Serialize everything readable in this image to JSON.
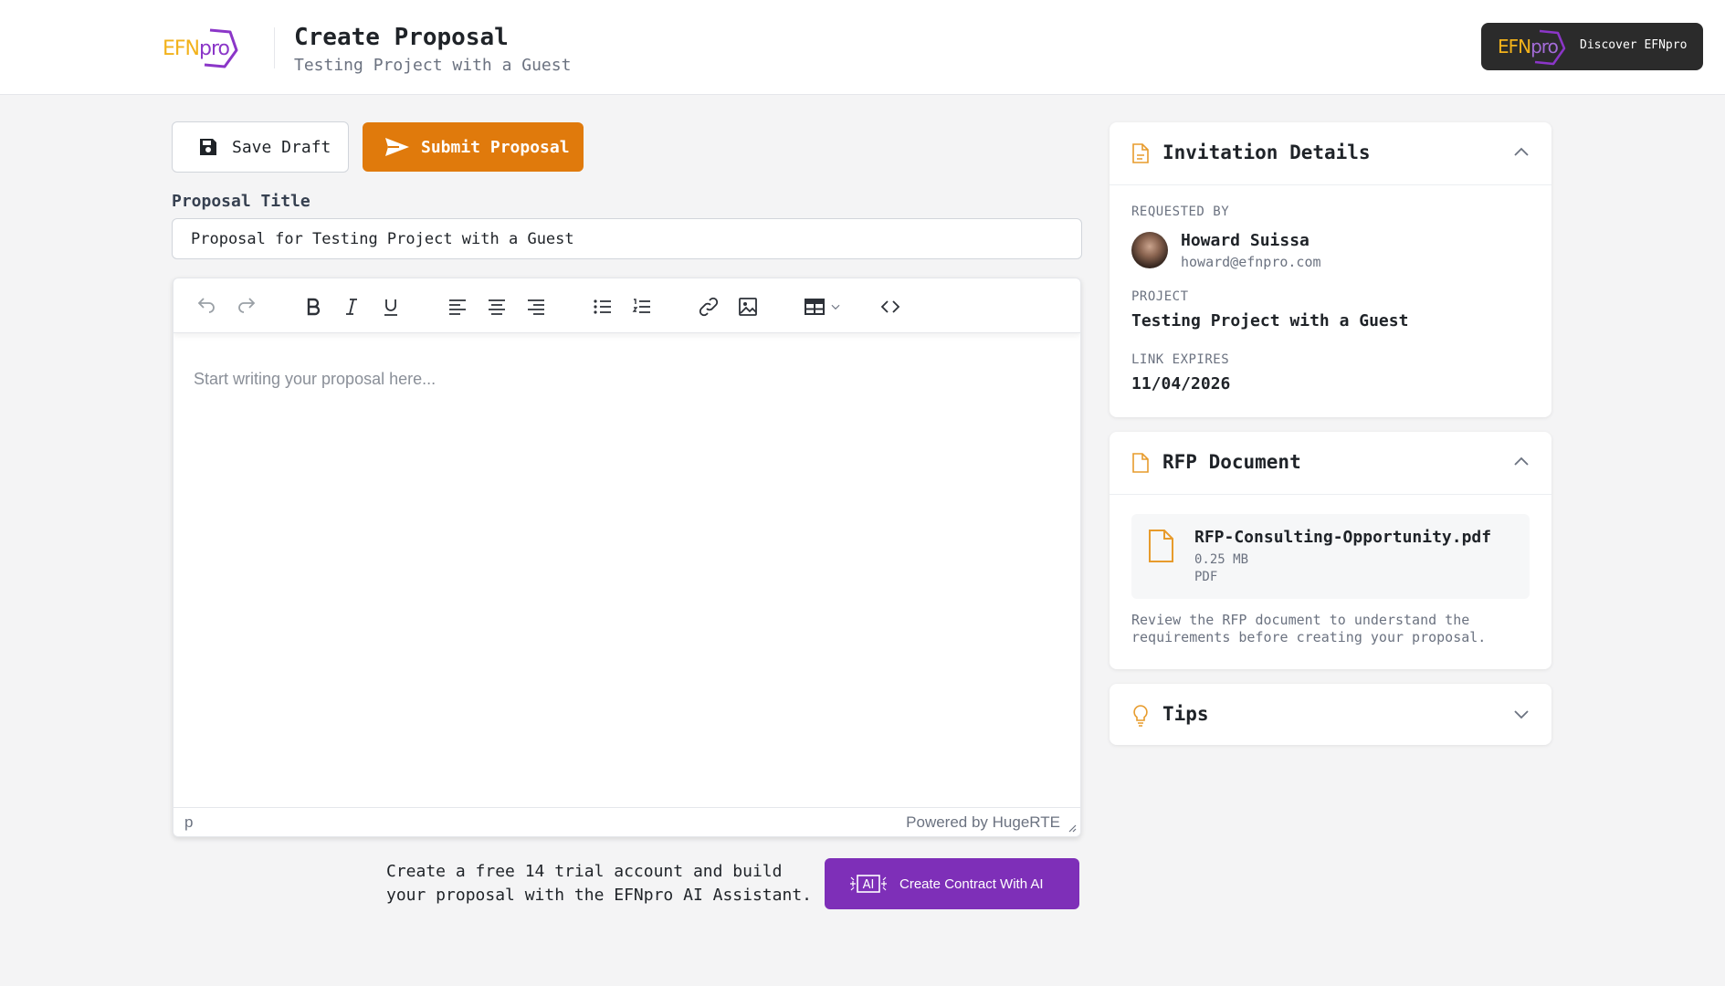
{
  "brand": {
    "logo_text_efn": "EFN",
    "logo_text_pro": "pro",
    "accent_orange": "#e07a0c",
    "accent_purple": "#7e2fb8",
    "accent_yellow": "#f2b21b"
  },
  "header": {
    "title": "Create Proposal",
    "subtitle": "Testing Project with a Guest",
    "discover_label": "Discover EFNpro"
  },
  "actions": {
    "save_label": "Save Draft",
    "submit_label": "Submit Proposal",
    "save_icon": "floppy-disk-icon",
    "submit_icon": "paper-plane-icon"
  },
  "form": {
    "title_label": "Proposal Title",
    "title_value": "Proposal for Testing Project with a Guest"
  },
  "editor": {
    "placeholder": "Start writing your proposal here...",
    "status_path": "p",
    "powered_by": "Powered by HugeRTE",
    "toolbar_icons": [
      "undo-icon",
      "redo-icon",
      "bold-icon",
      "italic-icon",
      "underline-icon",
      "align-left-icon",
      "align-center-icon",
      "align-right-icon",
      "bullet-list-icon",
      "numbered-list-icon",
      "link-icon",
      "image-icon",
      "table-icon",
      "code-icon"
    ]
  },
  "cta": {
    "text": "Create a free 14 trial account and build your proposal with the EFNpro AI Assistant.",
    "ai_button_label": "Create Contract With AI"
  },
  "invitation": {
    "title": "Invitation Details",
    "requested_by_label": "REQUESTED BY",
    "requester_name": "Howard Suissa",
    "requester_email": "howard@efnpro.com",
    "project_label": "PROJECT",
    "project_value": "Testing Project with a Guest",
    "expires_label": "LINK EXPIRES",
    "expires_value": "11/04/2026"
  },
  "rfp": {
    "title": "RFP Document",
    "file_name": "RFP-Consulting-Opportunity.pdf",
    "file_size": "0.25 MB",
    "file_type": "PDF",
    "note": "Review the RFP document to understand the requirements before creating your proposal."
  },
  "tips": {
    "title": "Tips"
  }
}
